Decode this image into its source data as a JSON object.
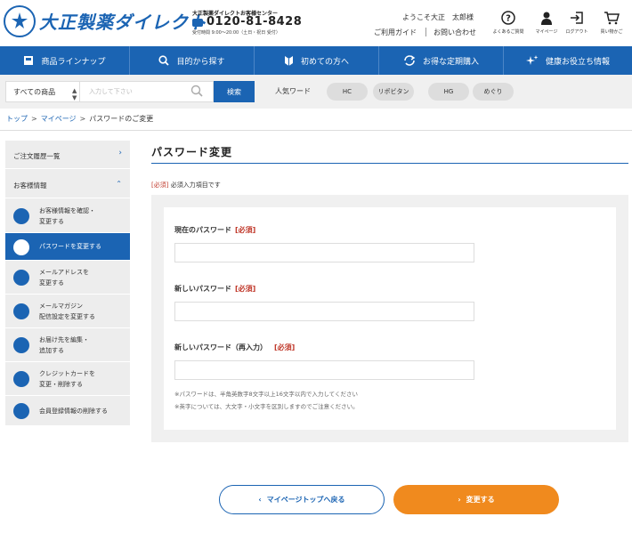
{
  "brand": {
    "logo_text": "大正製薬ダイレクト",
    "center_title": "大正製薬ダイレクトお客様センター",
    "phone": "0120-81-8428",
    "hours": "受付時間 9:00〜20:00（土日・祝日 受付）"
  },
  "header": {
    "welcome": "ようこそ大正　太郎様",
    "guide_link": "ご利用ガイド",
    "contact_link": "お問い合わせ",
    "icons": [
      {
        "icon": "question-icon",
        "label": "よくあるご質問"
      },
      {
        "icon": "person-icon",
        "label": "マイページ"
      },
      {
        "icon": "logout-icon",
        "label": "ログアウト"
      },
      {
        "icon": "cart-icon",
        "label": "買い物かご"
      }
    ]
  },
  "nav": [
    {
      "icon": "box-icon",
      "label": "商品ラインナップ"
    },
    {
      "icon": "search-icon",
      "label": "目的から探す"
    },
    {
      "icon": "beginner-icon",
      "label": "初めての方へ"
    },
    {
      "icon": "refresh-icon",
      "label": "お得な定期購入"
    },
    {
      "icon": "sparkle-icon",
      "label": "健康お役立ち情報"
    }
  ],
  "search": {
    "category": "すべての商品",
    "placeholder": "入力して下さい",
    "button": "検索",
    "popular_label": "人気ワード",
    "popular": [
      "HC",
      "リポビタン",
      "HG",
      "めぐり"
    ]
  },
  "breadcrumb": [
    "トップ",
    "マイページ",
    "パスワードのご変更"
  ],
  "sidebar": {
    "order_history": "ご注文履歴一覧",
    "customer_info": "お客様情報",
    "items": [
      {
        "icon": "person-icon",
        "label": "お客様情報を確認・\n変更する",
        "active": false
      },
      {
        "icon": "lock-icon",
        "label": "パスワードを変更する",
        "active": true
      },
      {
        "icon": "mail-icon",
        "label": "メールアドレスを\n変更する",
        "active": false
      },
      {
        "icon": "mail-open-icon",
        "label": "メールマガジン\n配信設定を変更する",
        "active": false
      },
      {
        "icon": "home-icon",
        "label": "お届け先を編集・\n追加する",
        "active": false
      },
      {
        "icon": "card-icon",
        "label": "クレジットカードを\n変更・削除する",
        "active": false
      },
      {
        "icon": "user-remove-icon",
        "label": "会員登録情報の削除する",
        "active": false
      }
    ]
  },
  "main": {
    "title": "パスワード変更",
    "required_tag": "[必須]",
    "required_note": "必須入力項目です",
    "fields": [
      {
        "label": "現在のパスワード",
        "req": "[必須]",
        "value": ""
      },
      {
        "label": "新しいパスワード",
        "req": "[必須]",
        "value": ""
      },
      {
        "label": "新しいパスワード（再入力）",
        "req": "[必須]",
        "value": ""
      }
    ],
    "notes": [
      "※パスワードは、半角英数字8文字以上16文字以内で入力してください",
      "※英字については、大文字・小文字を区別しますのでご注意ください。"
    ]
  },
  "buttons": {
    "back": "マイページトップへ戻る",
    "submit": "変更する"
  },
  "colors": {
    "primary": "#1b64b3",
    "accent": "#f08a1e",
    "required": "#c0392b"
  }
}
